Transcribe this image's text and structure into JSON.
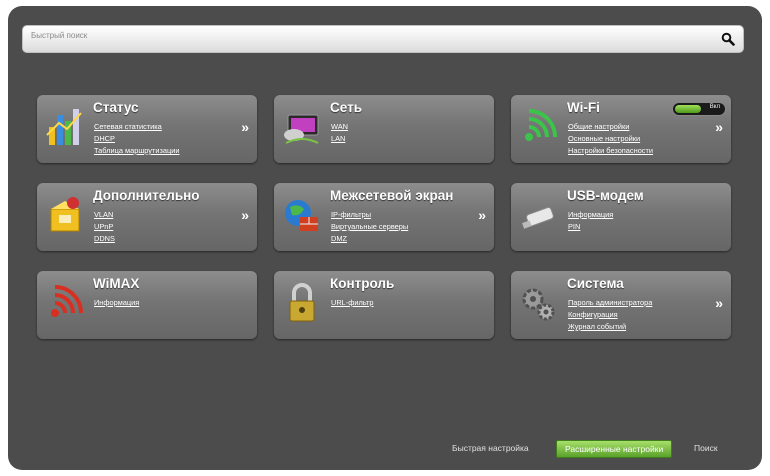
{
  "search": {
    "placeholder": "Быстрый поиск"
  },
  "tiles": [
    {
      "title": "Статус",
      "icon": "status-chart-icon",
      "links": [
        "Сетевая статистика",
        "DHCP",
        "Таблица маршрутизации"
      ]
    },
    {
      "title": "Сеть",
      "icon": "network-icon",
      "links": [
        "WAN",
        "LAN"
      ]
    },
    {
      "title": "Wi-Fi",
      "icon": "wifi-icon",
      "links": [
        "Общие настройки",
        "Основные настройки",
        "Настройки безопасности"
      ],
      "toggle_label": "Вкл"
    },
    {
      "title": "Дополнительно",
      "icon": "advanced-box-icon",
      "links": [
        "VLAN",
        "UPnP",
        "DDNS"
      ]
    },
    {
      "title": "Межсетевой экран",
      "icon": "firewall-globe-icon",
      "links": [
        "IP-фильтры",
        "Виртуальные серверы",
        "DMZ"
      ]
    },
    {
      "title": "USB-модем",
      "icon": "usb-modem-icon",
      "links": [
        "Информация",
        "PIN"
      ]
    },
    {
      "title": "WiMAX",
      "icon": "wimax-icon",
      "links": [
        "Информация"
      ]
    },
    {
      "title": "Контроль",
      "icon": "padlock-icon",
      "links": [
        "URL-фильтр"
      ]
    },
    {
      "title": "Система",
      "icon": "gears-icon",
      "links": [
        "Пароль администратора",
        "Конфигурация",
        "Журнал событий"
      ]
    }
  ],
  "footer": {
    "quick_setup": "Быстрая настройка",
    "advanced_setup": "Расширенные настройки",
    "search": "Поиск"
  },
  "colors": {
    "background": "#4c4c4c",
    "tile": "#7a7a7a",
    "accent_green": "#7cc243",
    "wifi_green": "#3cc44a",
    "wimax_red": "#d83020"
  }
}
